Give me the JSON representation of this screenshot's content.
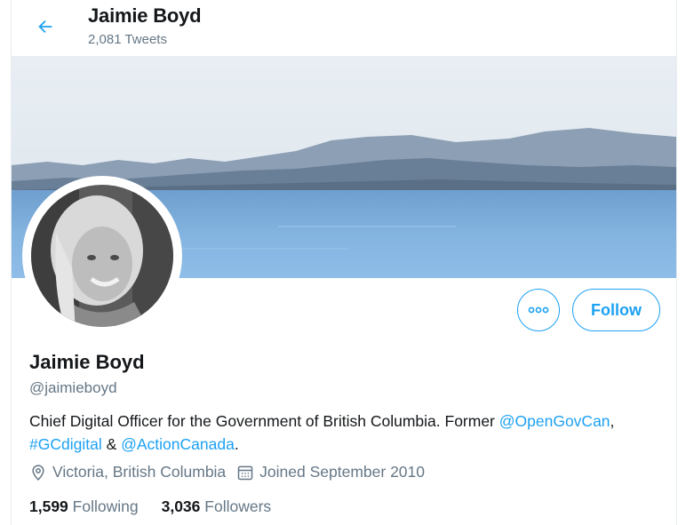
{
  "header": {
    "name": "Jaimie Boyd",
    "tweet_count": "2,081 Tweets"
  },
  "profile": {
    "display_name": "Jaimie Boyd",
    "handle": "@jaimieboyd",
    "bio": {
      "text1": "Chief Digital Officer for the Government of British Columbia. Former ",
      "link1": "@OpenGovCan",
      "text2": ",",
      "link2": "#GCdigital",
      "text3": " & ",
      "link3": "@ActionCanada",
      "text4": "."
    },
    "location": "Victoria, British Columbia",
    "joined": "Joined September 2010",
    "following_count": "1,599",
    "following_label": "Following",
    "followers_count": "3,036",
    "followers_label": "Followers"
  },
  "actions": {
    "follow_label": "Follow"
  },
  "colors": {
    "accent": "#1da1f2",
    "secondary_text": "#657786"
  },
  "icons": {
    "back": "arrow-left-icon",
    "more": "more-horizontal-icon",
    "location": "location-pin-icon",
    "calendar": "calendar-icon"
  }
}
